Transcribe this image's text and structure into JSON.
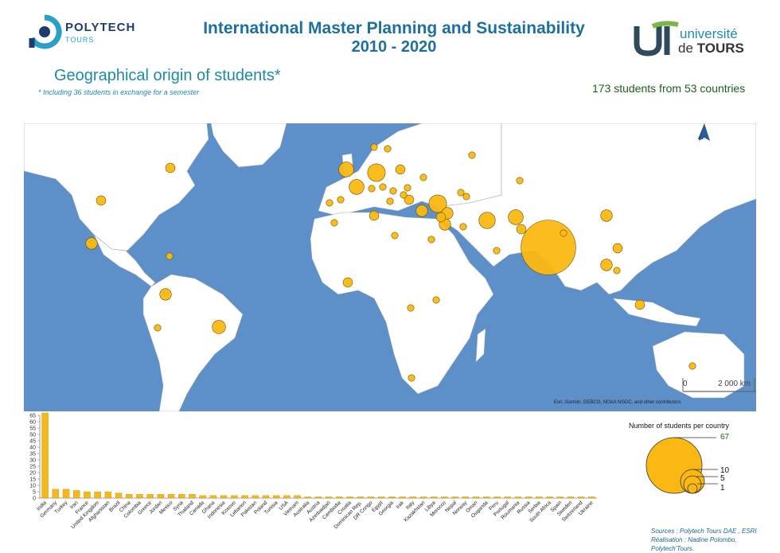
{
  "header": {
    "left_logo_name": "POLYTECH",
    "left_logo_sub": "TOURS",
    "title_line1": "International Master Planning and Sustainability",
    "title_line2": "2010 - 2020",
    "right_logo_line1": "université",
    "right_logo_line2a": "de ",
    "right_logo_line2b": "TOURS"
  },
  "subtitle": "Geographical origin of students*",
  "footnote": "* Including 36 students in exchange for a semester",
  "summary": "173 students from 53 countries",
  "map": {
    "north_label": "N",
    "scale_zero": "0",
    "scale_label": "2 000 km",
    "attribution": "Esri, Garmin, GEBCO, NOAA NGDC, and other contributors",
    "ocean_color": "#5d8fc9",
    "land_color": "#ffffff",
    "symbol_color": "#fbb812"
  },
  "legend": {
    "title": "Number of students per country",
    "values": [
      "67",
      "10",
      "5",
      "1"
    ]
  },
  "sources_line1": "Sources : Polytech Tours DAE , ESRI",
  "sources_line2": "Réalisation : Nadine Polombo,  Polytech'Tours.",
  "chart_data": {
    "type": "bar",
    "ylim": [
      0,
      65
    ],
    "yticks": [
      0,
      5,
      10,
      15,
      20,
      25,
      30,
      35,
      40,
      45,
      50,
      55,
      60,
      65
    ],
    "categories": [
      "India",
      "Germany",
      "Turkey",
      "Iran",
      "France",
      "United Kingdom",
      "Afghanistan",
      "Brazil",
      "China",
      "Colombia",
      "Greece",
      "Jordan",
      "Mexico",
      "Syria",
      "Thailand",
      "Canada",
      "Ghana",
      "Indonesia",
      "Kosovo",
      "Lebanon",
      "Pakistan",
      "Poland",
      "Tunisia",
      "USA",
      "Vietnam",
      "Australia",
      "Austria",
      "Azerbaidjan",
      "Cambodia",
      "Croatia",
      "Dominican Rep.",
      "DR Congo",
      "Egypt",
      "Georgia",
      "Irak",
      "Italy",
      "Kazakhstan",
      "Libya",
      "Morocco",
      "Nepal",
      "Norway",
      "Oman",
      "Ouganda",
      "Peru",
      "Portugal",
      "Roumania",
      "Russia",
      "Serbia",
      "South Africa",
      "Spain",
      "Sweden",
      "Switzerland",
      "Ukraine"
    ],
    "values": [
      67,
      7,
      7,
      6,
      5,
      5,
      5,
      4,
      3,
      3,
      3,
      3,
      3,
      3,
      3,
      2,
      2,
      2,
      2,
      2,
      2,
      2,
      2,
      2,
      2,
      1,
      1,
      1,
      1,
      1,
      1,
      1,
      1,
      1,
      1,
      1,
      1,
      1,
      1,
      1,
      1,
      1,
      1,
      1,
      1,
      1,
      1,
      1,
      1,
      1,
      1,
      1,
      1
    ],
    "bar_color": "#f3b81c"
  }
}
